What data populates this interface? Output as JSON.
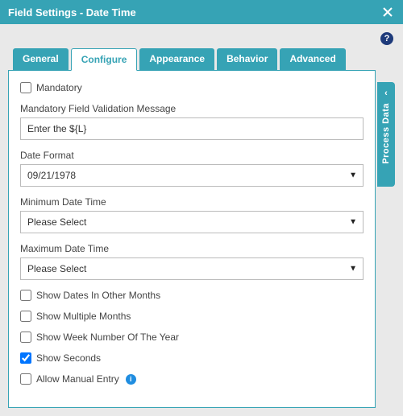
{
  "title": "Field Settings - Date Time",
  "help_tooltip": "?",
  "tabs": {
    "general": "General",
    "configure": "Configure",
    "appearance": "Appearance",
    "behavior": "Behavior",
    "advanced": "Advanced"
  },
  "side_panel": {
    "label": "Process Data",
    "chevron": "‹"
  },
  "form": {
    "mandatory_label": "Mandatory",
    "mandatory_checked": false,
    "validation_msg_label": "Mandatory Field Validation Message",
    "validation_msg_value": "Enter the ${L}",
    "date_format_label": "Date Format",
    "date_format_value": "09/21/1978",
    "min_dt_label": "Minimum Date Time",
    "min_dt_value": "Please Select",
    "max_dt_label": "Maximum Date Time",
    "max_dt_value": "Please Select",
    "show_other_months_label": "Show Dates In Other Months",
    "show_other_months_checked": false,
    "show_multiple_months_label": "Show Multiple Months",
    "show_multiple_months_checked": false,
    "show_week_num_label": "Show Week Number Of The Year",
    "show_week_num_checked": false,
    "show_seconds_label": "Show Seconds",
    "show_seconds_checked": true,
    "allow_manual_label": "Allow Manual Entry",
    "allow_manual_checked": false,
    "info_glyph": "i"
  }
}
